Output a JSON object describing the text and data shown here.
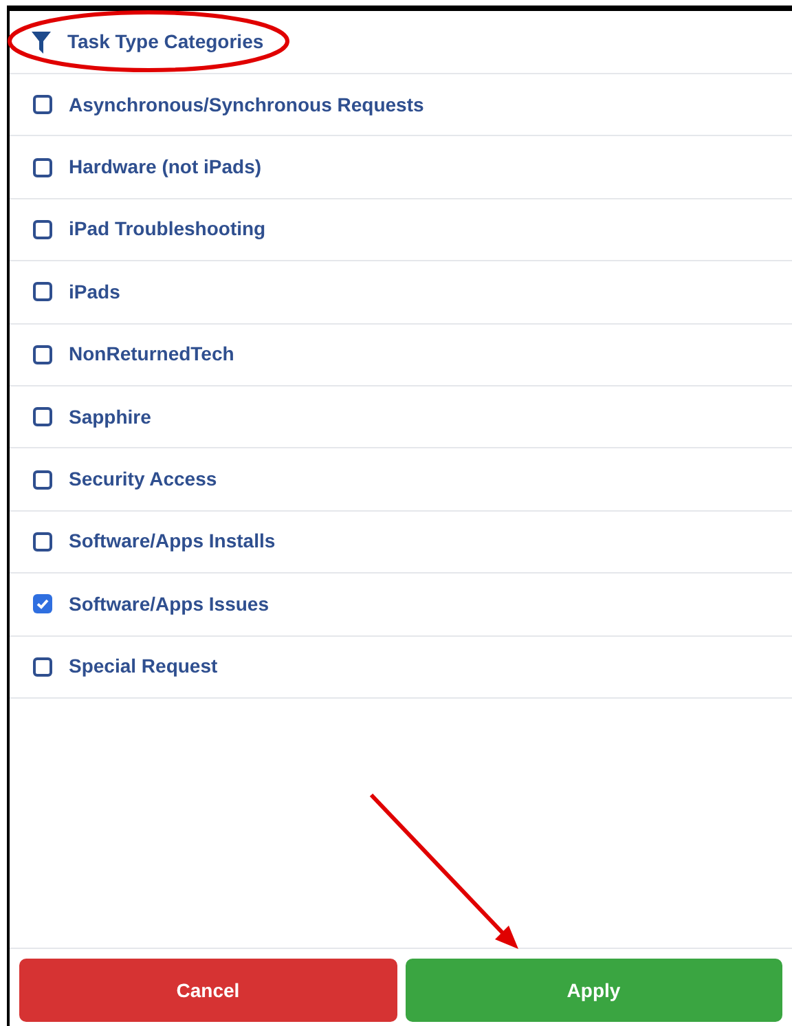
{
  "header": {
    "title": "Task Type Categories"
  },
  "categories": [
    {
      "label": "Asynchronous/Synchronous Requests",
      "checked": false
    },
    {
      "label": "Hardware (not iPads)",
      "checked": false
    },
    {
      "label": "iPad Troubleshooting",
      "checked": false
    },
    {
      "label": "iPads",
      "checked": false
    },
    {
      "label": "NonReturnedTech",
      "checked": false
    },
    {
      "label": "Sapphire",
      "checked": false
    },
    {
      "label": "Security Access",
      "checked": false
    },
    {
      "label": "Software/Apps Installs",
      "checked": false
    },
    {
      "label": "Software/Apps Issues",
      "checked": true
    },
    {
      "label": "Special Request",
      "checked": false
    }
  ],
  "buttons": [
    {
      "label": "Cancel",
      "kind": "cancel"
    },
    {
      "label": "Apply",
      "kind": "apply"
    }
  ]
}
